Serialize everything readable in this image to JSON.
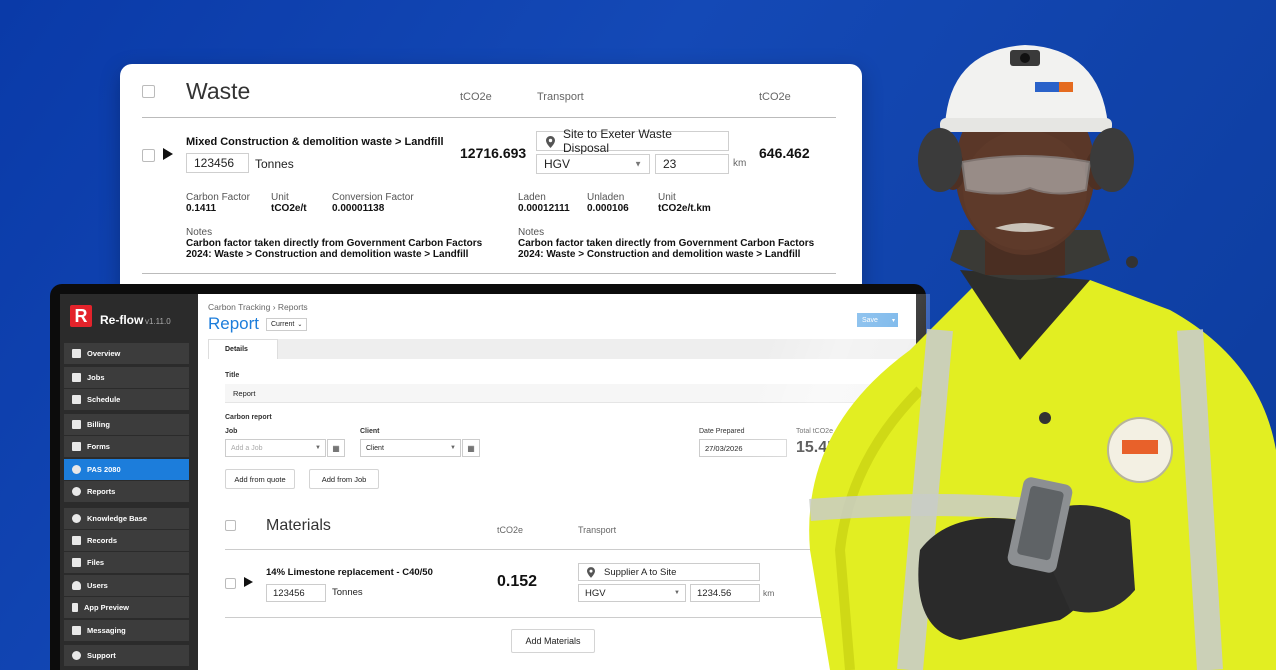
{
  "waste_card": {
    "title": "Waste",
    "col_tco2e": "tCO2e",
    "col_transport": "Transport",
    "col_tco2e_2": "tCO2e",
    "item_name": "Mixed Construction & demolition waste > Landfill",
    "quantity": "123456",
    "quantity_unit": "Tonnes",
    "tco2e_value": "12716.693",
    "route": "Site to Exeter Waste Disposal",
    "vehicle": "HGV",
    "distance": "23",
    "distance_unit": "km",
    "transport_tco2e": "646.462",
    "carbon_factor_label": "Carbon Factor",
    "carbon_factor_value": "0.1411",
    "unit_label": "Unit",
    "unit_value": "tCO2e/t",
    "conversion_label": "Conversion Factor",
    "conversion_value": "0.00001138",
    "laden_label": "Laden",
    "laden_value": "0.00012111",
    "unladen_label": "Unladen",
    "unladen_value": "0.000106",
    "unit2_label": "Unit",
    "unit2_value": "tCO2e/t.km",
    "notes_label": "Notes",
    "notes_value": "Carbon factor taken directly from Government Carbon Factors 2024: Waste > Construction and demolition waste > Landfill",
    "notes2_label": "Notes",
    "notes2_value": "Carbon factor taken directly from Government Carbon Factors 2024: Waste > Construction and demolition waste > Landfill"
  },
  "app": {
    "logo_letter": "R",
    "brand": "Re-flow",
    "version": "v1.11.0",
    "nav": [
      {
        "label": "Overview",
        "icon": "home-icon"
      },
      {
        "label": "Jobs",
        "icon": "jobs-icon"
      },
      {
        "label": "Schedule",
        "icon": "calendar-icon"
      },
      {
        "label": "Billing",
        "icon": "billing-icon"
      },
      {
        "label": "Forms",
        "icon": "forms-icon"
      },
      {
        "label": "PAS 2080",
        "icon": "cloud-icon"
      },
      {
        "label": "Reports",
        "icon": "pie-chart-icon"
      },
      {
        "label": "Knowledge Base",
        "icon": "lightbulb-icon"
      },
      {
        "label": "Records",
        "icon": "records-icon"
      },
      {
        "label": "Files",
        "icon": "file-icon"
      },
      {
        "label": "Users",
        "icon": "user-icon"
      },
      {
        "label": "App Preview",
        "icon": "mobile-icon"
      },
      {
        "label": "Messaging",
        "icon": "chat-icon"
      },
      {
        "label": "Support",
        "icon": "help-icon"
      }
    ],
    "breadcrumb": "Carbon Tracking › Reports",
    "page_title": "Report",
    "version_select": "Current",
    "save_label": "Save",
    "tab_details": "Details",
    "title_label": "Title",
    "title_value": "Report",
    "carbon_report_label": "Carbon report",
    "job_label": "Job",
    "job_placeholder": "Add a Job",
    "client_label": "Client",
    "client_value": "Client",
    "date_label": "Date Prepared",
    "date_value": "27/03/2026",
    "total_label": "Total tCO2e",
    "total_value": "15.456",
    "add_from_quote": "Add from quote",
    "add_from_job": "Add from Job",
    "materials": {
      "title": "Materials",
      "col_tco2e": "tCO2e",
      "col_transport": "Transport",
      "item_name": "14% Limestone replacement - C40/50",
      "quantity": "123456",
      "quantity_unit": "Tonnes",
      "tco2e_value": "0.152",
      "route": "Supplier A to Site",
      "vehicle": "HGV",
      "distance": "1234.56",
      "distance_unit": "km",
      "add_button": "Add Materials"
    }
  },
  "colors": {
    "background": "#1146b3",
    "accent": "#1c7ddb",
    "brand_red": "#e3232b",
    "hi_vis": "#e4f11a"
  }
}
